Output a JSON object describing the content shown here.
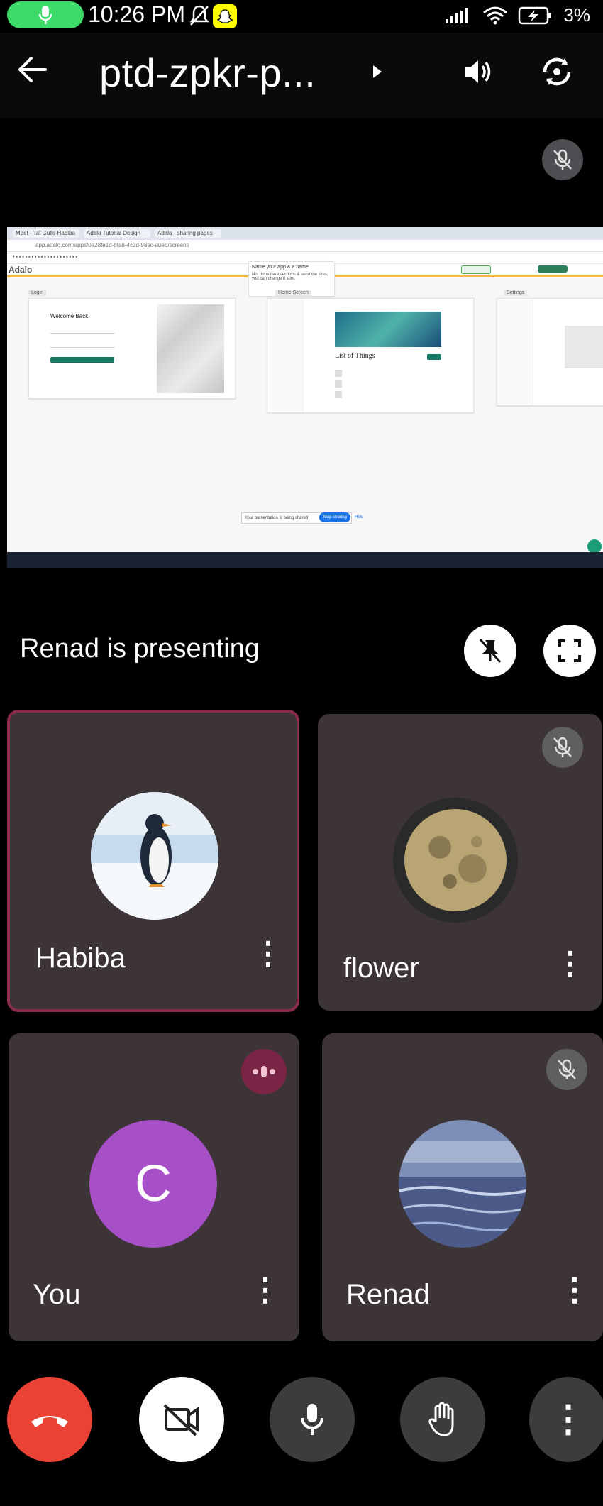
{
  "status_bar": {
    "time": "10:26 PM",
    "battery": "3%"
  },
  "app_bar": {
    "meeting_code": "ptd-zpkr-p..."
  },
  "shared_screen": {
    "browser_tabs": [
      "Meet - Tat Gulki-Habiba",
      "Adalo Tutorial Design",
      "Adalo - sharing pages"
    ],
    "url": "app.adalo.com/apps/0a28fe1d-bfa8-4c2d-989c-a0eb/screens",
    "app_logo": "Adalo",
    "popup_title": "Name your app & a name",
    "popup_body": "Not done here sections & send the sites, you can change it later.",
    "screen_cards": [
      {
        "label": "Login",
        "heading": "Welcome Back!"
      },
      {
        "label": "Home Screen",
        "heading": "List of Things"
      },
      {
        "label": "Settings",
        "heading": ""
      }
    ],
    "share_bar_text": "Your presentation is being shared",
    "share_bar_button": "Stop sharing",
    "share_bar_hide": "Hide"
  },
  "presenting": {
    "label": "Renad is presenting"
  },
  "participants": [
    {
      "name": "Habiba",
      "avatar": "penguin",
      "muted": false,
      "active": true
    },
    {
      "name": "flower",
      "avatar": "moon",
      "muted": true,
      "active": false
    },
    {
      "name": "You",
      "avatar_letter": "C",
      "muted": false,
      "speaking": true
    },
    {
      "name": "Renad",
      "avatar": "sea",
      "muted": true,
      "active": false
    }
  ],
  "colors": {
    "tile_bg": "#3c3436",
    "active_border": "#8a2b4a",
    "end_call": "#ea4335",
    "you_avatar": "#a74fc7",
    "speaking_badge": "#7a2446",
    "control_bg": "#3c3c3f"
  }
}
